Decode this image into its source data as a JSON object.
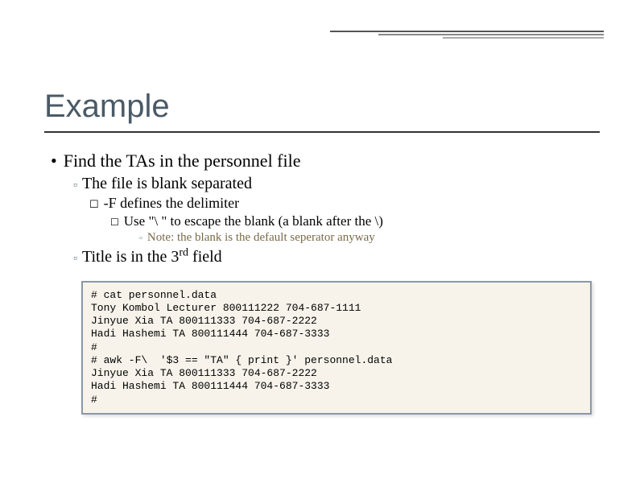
{
  "title": "Example",
  "bullets": {
    "l1": "Find the TAs in the personnel file",
    "l2a": "The file is blank separated",
    "l3a": "-F defines the delimiter",
    "l4a": "Use \"\\  \" to escape the blank  (a blank after the \\)",
    "l5a": "Note: the blank is the default seperator anyway",
    "l2b_pre": "Title is in the 3",
    "l2b_sup": "rd",
    "l2b_post": " field"
  },
  "code": "# cat personnel.data\nTony Kombol Lecturer 800111222 704-687-1111\nJinyue Xia TA 800111333 704-687-2222\nHadi Hashemi TA 800111444 704-687-3333\n#\n# awk -F\\  '$3 == \"TA\" { print }' personnel.data\nJinyue Xia TA 800111333 704-687-2222\nHadi Hashemi TA 800111444 704-687-3333\n#"
}
